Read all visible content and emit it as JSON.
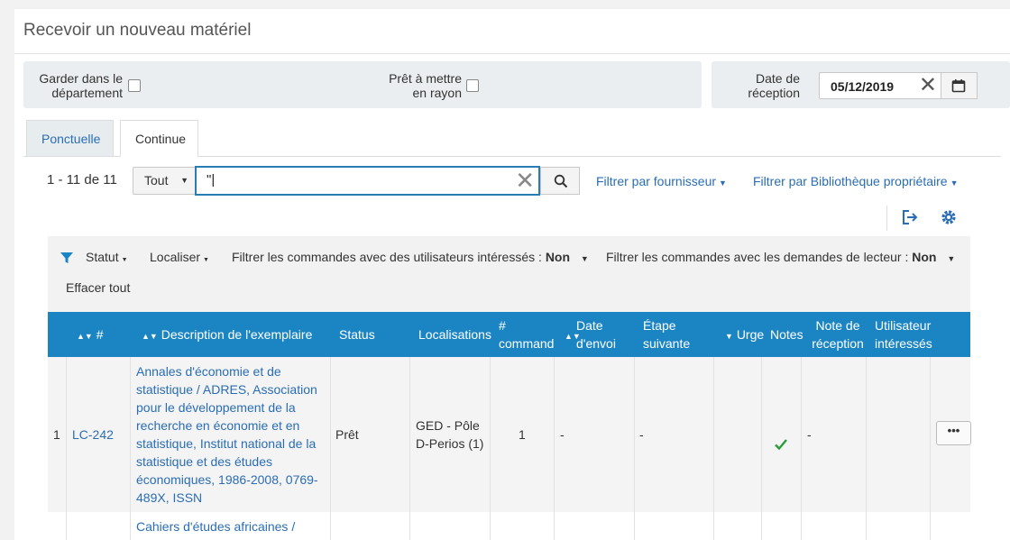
{
  "page_title": "Recevoir un nouveau matériel",
  "options": {
    "keep_in_department": "Garder dans le département",
    "keep_line1": "Garder dans le",
    "keep_line2": "département",
    "ready_line1": "Prêt à mettre",
    "ready_line2": "en rayon",
    "date_line1": "Date de",
    "date_line2": "réception",
    "date_value": "05/12/2019"
  },
  "tabs": [
    {
      "label": "Ponctuelle",
      "active": false
    },
    {
      "label": "Continue",
      "active": true
    }
  ],
  "results": {
    "count": "1 - 11 de 11",
    "scope": "Tout",
    "search_value": "\"|"
  },
  "filters": {
    "vendor": "Filtrer par fournisseur",
    "library": "Filtrer par Bibliothèque propriétaire",
    "status": "Statut",
    "locate": "Localiser",
    "interested_users": "Filtrer les commandes avec des utilisateurs intéressés :",
    "interested_users_value": "Non",
    "reader_requests": "Filtrer les commandes avec les demandes de lecteur :",
    "reader_requests_value": "Non",
    "clear_all": "Effacer tout"
  },
  "table": {
    "headers": {
      "num": "#",
      "description": "Description de l'exemplaire",
      "status": "Status",
      "locations_a": "Localisations",
      "orders_a": "#",
      "orders_b": "commande",
      "send_date_a": "Date",
      "send_date_b": "d'envoi",
      "next_step_a": "Étape",
      "next_step_b": "suivante",
      "urgent": "Urge",
      "notes": "Notes",
      "receipt_note_a": "Note de",
      "receipt_note_b": "réception",
      "interested_a": "Utilisateur",
      "interested_b": "intéressés"
    },
    "rows": [
      {
        "index": "1",
        "code": "LC-242",
        "desc_lines": [
          "Annales d'économie et de",
          "statistique / ADRES, Association",
          "pour le développement de la",
          "recherche en économie et en",
          "statistique, Institut national de la",
          "statistique et des études",
          "économiques, 1986-2008, 0769-",
          "489X, ISSN"
        ],
        "status": "Prêt",
        "location_a": "GED - Pôle",
        "location_b": "D-Perios (1)",
        "orders": "1",
        "send_date": "-",
        "next_step": "-",
        "receipt_note": "-",
        "more": "•••"
      },
      {
        "desc_line": "Cahiers d'études africaines /"
      }
    ]
  },
  "colors": {
    "header_blue": "#1b85c4",
    "link_blue": "#2a6db4",
    "check_green": "#2a9d3a"
  }
}
